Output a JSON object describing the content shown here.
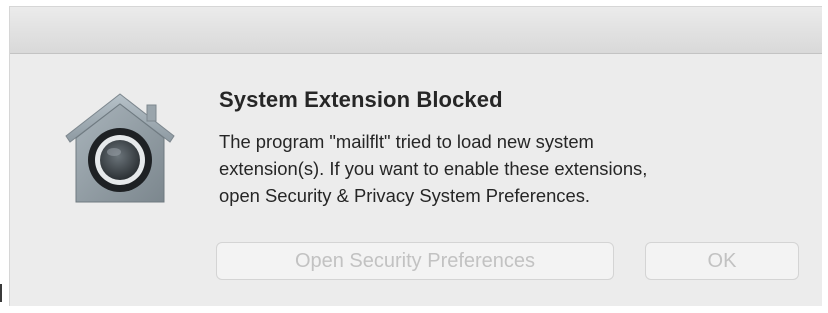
{
  "dialog": {
    "title": "System Extension Blocked",
    "message_lines": [
      "The program \"mailflt\" tried to load new system",
      "extension(s). If you want to enable these extensions,",
      "open Security & Privacy System Preferences."
    ],
    "icon": "security-lock-house-icon"
  },
  "buttons": {
    "open_security_label": "Open Security Preferences",
    "ok_label": "OK",
    "state": "disabled"
  }
}
